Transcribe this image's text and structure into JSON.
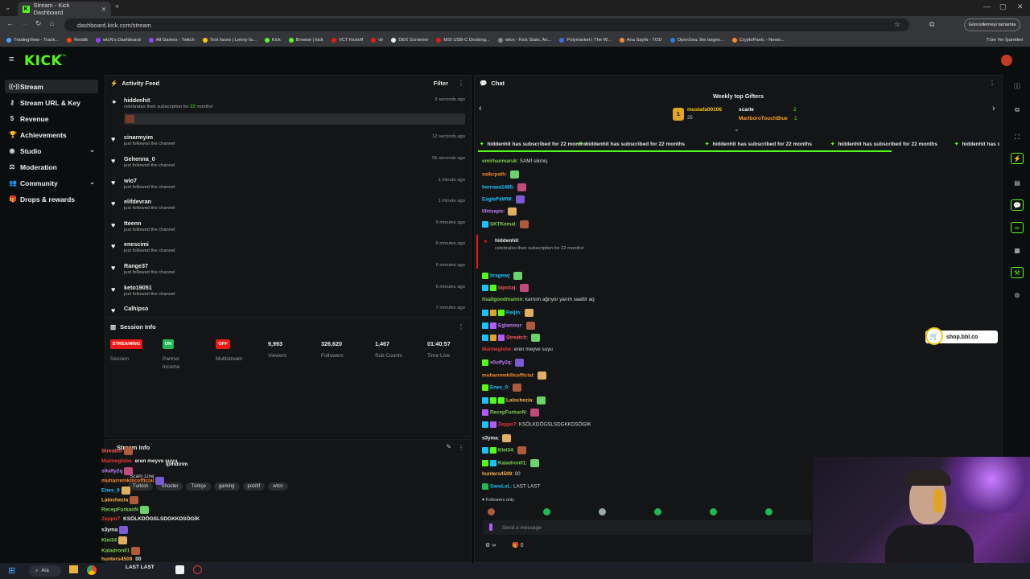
{
  "browser": {
    "tab_title": "Stream - Kick Dashboard",
    "url": "dashboard.kick.com/stream",
    "update_button": "Güncellemeyi tamamla",
    "bookmarks": [
      "TradingView - Track...",
      "Reddit",
      "wtcN's Dashboard",
      "All Games - Twitch",
      "Text faces | Lenny fa...",
      "Kick",
      "Browse | kick",
      "VCT Kickoff",
      "vlr",
      "DEX Screener",
      "MSI USB-C Docking...",
      "wtcn - Kick Stats, An...",
      "Polymarket | The W...",
      "Ana Sayfa - TOD",
      "OpenSea, the larges...",
      "CryptoPanic - News..."
    ],
    "all_bookmarks": "Tüm Yer İşaretleri"
  },
  "app": {
    "logo": "KICK",
    "beta": "BETA"
  },
  "sidebar": {
    "items": [
      {
        "label": "Stream",
        "icon": "broadcast-icon"
      },
      {
        "label": "Stream URL & Key",
        "icon": "key-icon"
      },
      {
        "label": "Revenue",
        "icon": "dollar-icon"
      },
      {
        "label": "Achievements",
        "icon": "trophy-icon"
      },
      {
        "label": "Studio",
        "icon": "palette-icon"
      },
      {
        "label": "Moderation",
        "icon": "gavel-icon"
      },
      {
        "label": "Community",
        "icon": "users-icon"
      },
      {
        "label": "Drops & rewards",
        "icon": "gift-icon"
      }
    ]
  },
  "activity": {
    "title": "Activity Feed",
    "filter": "Filter",
    "items": [
      {
        "name": "hiddenhit",
        "sub_pre": "celebrates their subscription for ",
        "sub_num": "22",
        "sub_post": " months!",
        "time": "3 seconds ago"
      },
      {
        "name": "cinarmyim",
        "sub": "just followed the channel",
        "time": "12 seconds ago"
      },
      {
        "name": "Gehenna_0",
        "sub": "just followed the channel",
        "time": "55 seconds ago"
      },
      {
        "name": "wio7",
        "sub": "just followed the channel",
        "time": "1 minute ago"
      },
      {
        "name": "elifdevran",
        "sub": "just followed the channel",
        "time": "1 minute ago"
      },
      {
        "name": "tteenn",
        "sub": "just followed the channel",
        "time": "5 minutes ago"
      },
      {
        "name": "enescimi",
        "sub": "just followed the channel",
        "time": "6 minutes ago"
      },
      {
        "name": "Range37",
        "sub": "just followed the channel",
        "time": "6 minutes ago"
      },
      {
        "name": "keto19051",
        "sub": "just followed the channel",
        "time": "6 minutes ago"
      },
      {
        "name": "Calhipso",
        "sub": "",
        "time": "7 minutes ago"
      }
    ]
  },
  "session": {
    "title": "Session Info",
    "badges": [
      {
        "text": "STREAMING",
        "label": "Session",
        "color": "#e91916"
      },
      {
        "text": "ON",
        "label": "Partner Income",
        "color": "#1db954"
      },
      {
        "text": "OFF",
        "label": "Multistream",
        "color": "#e91916"
      }
    ],
    "stats": [
      {
        "value": "9,993",
        "label": "Viewers"
      },
      {
        "value": "326,620",
        "label": "Followers"
      },
      {
        "value": "1,467",
        "label": "Sub Counts"
      },
      {
        "value": "01:40:57",
        "label": "Time Live"
      }
    ]
  },
  "stream_info": {
    "title": "Stream Info",
    "subtitle": "Scam Line",
    "tags": [
      "Turkish",
      "Shooter",
      "Türkçe",
      "gaming",
      "pozitif",
      "wtcn"
    ]
  },
  "overlay_chat": [
    {
      "name": "Streatch",
      "color": "#ff5a5a",
      "msg": ""
    },
    {
      "name": "Maimeglobe",
      "color": "#e53935",
      "msg": "eren meyve suyu"
    },
    {
      "name": "s0ulfy2q",
      "color": "#c47cff",
      "msg": ""
    },
    {
      "name": "muharremkilicofficial",
      "color": "#ff8a2a",
      "msg": ""
    },
    {
      "name": "Enes_0",
      "color": "#19c3ff",
      "msg": ""
    },
    {
      "name": "Lalochezia",
      "color": "#ffb347",
      "msg": ""
    },
    {
      "name": "RecepFurkanN",
      "color": "#7cd04f",
      "msg": ""
    },
    {
      "name": "Zeppo7",
      "color": "#e53935",
      "msg": "KSÖLKDÖGSLSDGKKDSÖGİK"
    },
    {
      "name": "s3yma",
      "color": "#f0f0f0",
      "msg": ""
    },
    {
      "name": "Klei34",
      "color": "#7cd04f",
      "msg": ""
    },
    {
      "name": "Kaladron01",
      "color": "#7cd04f",
      "msg": ""
    },
    {
      "name": "hunters4509",
      "color": "#ffb347",
      "msg": "00"
    }
  ],
  "overlay_misc": {
    "ipindirim": "İpindirim",
    "last": "LAST LAST"
  },
  "chat": {
    "title": "Chat",
    "gifters_title": "Weekly top Gifters",
    "gifters": [
      {
        "name": "mustafa00106",
        "count": "25",
        "color": "#ffcc00"
      },
      {
        "name": "scarle",
        "count": "2",
        "color": "#ffffff"
      },
      {
        "name": "MarlboroTouchBlue",
        "count": "1",
        "color": "#ff9f2a"
      }
    ],
    "marquee": "hiddenhit has subscribed for 22 months",
    "messages": [
      {
        "name": "emirhanmaruk",
        "color": "#7cd04f",
        "msg": "SAMİ sikmiş"
      },
      {
        "name": "saikcpath",
        "color": "#ff8a2a",
        "msg": ""
      },
      {
        "name": "bernaaa1485",
        "color": "#19c3ff",
        "msg": ""
      },
      {
        "name": "EaglePaWW",
        "color": "#19c3ff",
        "msg": ""
      },
      {
        "name": "lifeisepic",
        "color": "#c47cff",
        "msg": ""
      },
      {
        "name": "SKTKemal",
        "color": "#7cd04f",
        "msg": ""
      },
      {
        "name": "bragewj",
        "color": "#19c3ff",
        "msg": ""
      },
      {
        "name": "lapozaj",
        "color": "#ff5a5a",
        "msg": ""
      },
      {
        "name": "itsallgoodmannn",
        "color": "#7cd04f",
        "msg": "karnım ağrıyor yarım saattir aq"
      },
      {
        "name": "Reijin",
        "color": "#19c3ff",
        "msg": ""
      },
      {
        "name": "Eglamour",
        "color": "#c47cff",
        "msg": ""
      },
      {
        "name": "Streatch",
        "color": "#ff5a5a",
        "msg": ""
      },
      {
        "name": "Maimeglobe",
        "color": "#e53935",
        "msg": "eren meyve suyu"
      },
      {
        "name": "s0ulfy2q",
        "color": "#c47cff",
        "msg": ""
      },
      {
        "name": "muharremkilicofficial",
        "color": "#ff8a2a",
        "msg": ""
      },
      {
        "name": "Enes_0",
        "color": "#19c3ff",
        "msg": ""
      },
      {
        "name": "Lalochezia",
        "color": "#ffb347",
        "msg": ""
      },
      {
        "name": "RecepFurkanN",
        "color": "#7cd04f",
        "msg": ""
      },
      {
        "name": "Zeppo7",
        "color": "#e53935",
        "msg": "KSÖLKDÖGSLSDGKKDSÖGİK"
      },
      {
        "name": "s3yma",
        "color": "#f0f0f0",
        "msg": ""
      },
      {
        "name": "Klei34",
        "color": "#7cd04f",
        "msg": ""
      },
      {
        "name": "Kaladron01",
        "color": "#7cd04f",
        "msg": ""
      },
      {
        "name": "hunters4509",
        "color": "#ffb347",
        "msg": "00"
      },
      {
        "name": "SaruLoL",
        "color": "#19c3ff",
        "msg": "LAST LAST"
      }
    ],
    "sub_event": {
      "name": "hiddenhit",
      "text": "celebrates their subscription for 22 months!"
    },
    "followers_only": "Followers only",
    "input_placeholder": "Send a message",
    "bottom_count": "0"
  },
  "shop_overlay": "shop.bbl.co",
  "taskbar": {
    "search": "Ara"
  }
}
